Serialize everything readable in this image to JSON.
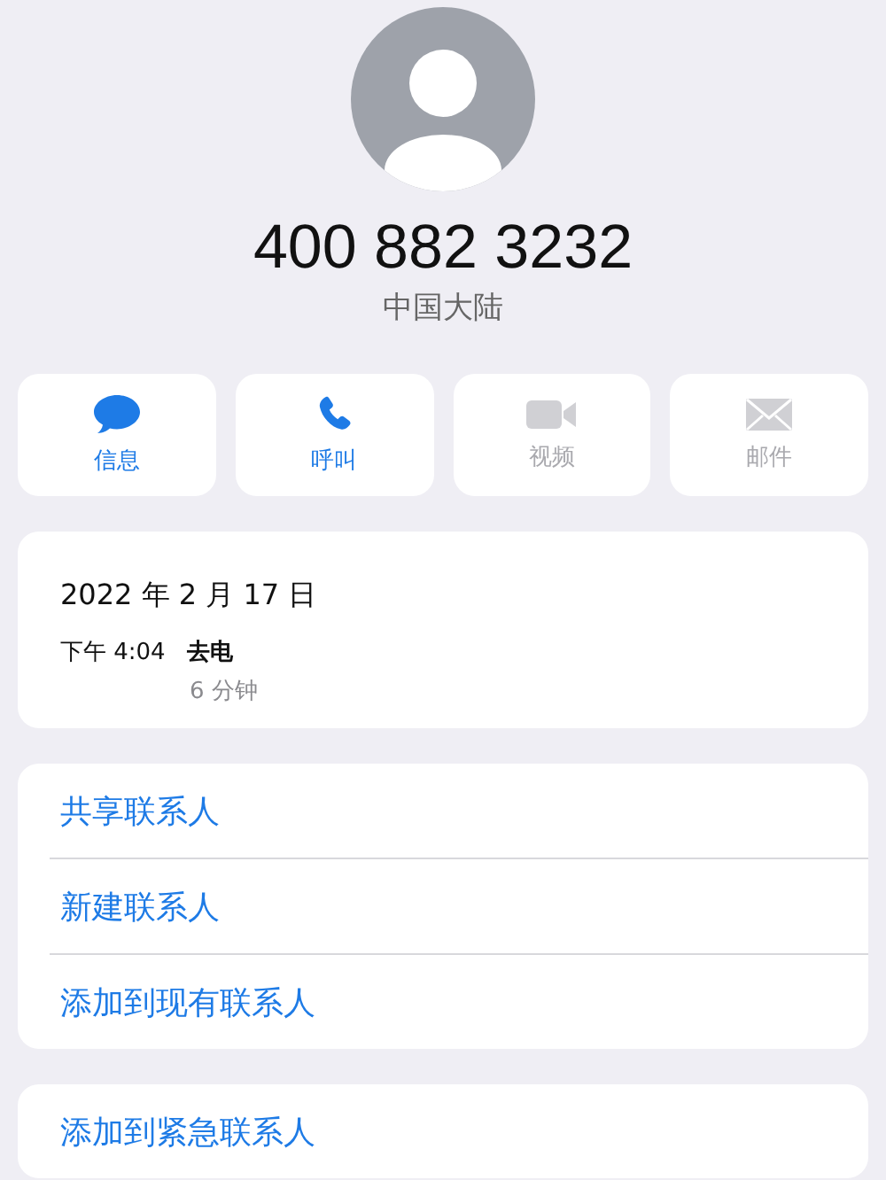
{
  "contact": {
    "number": "400 882 3232",
    "region": "中国大陆"
  },
  "actions": [
    {
      "kind": "message",
      "label": "信息",
      "disabled": false
    },
    {
      "kind": "call",
      "label": "呼叫",
      "disabled": false
    },
    {
      "kind": "video",
      "label": "视频",
      "disabled": true
    },
    {
      "kind": "mail",
      "label": "邮件",
      "disabled": true
    }
  ],
  "call_log": {
    "date": "2022 年 2 月 17 日",
    "time": "下午 4:04",
    "type": "去电",
    "duration": "6 分钟"
  },
  "menu_groups": [
    [
      "共享联系人",
      "新建联系人",
      "添加到现有联系人"
    ],
    [
      "添加到紧急联系人"
    ]
  ]
}
